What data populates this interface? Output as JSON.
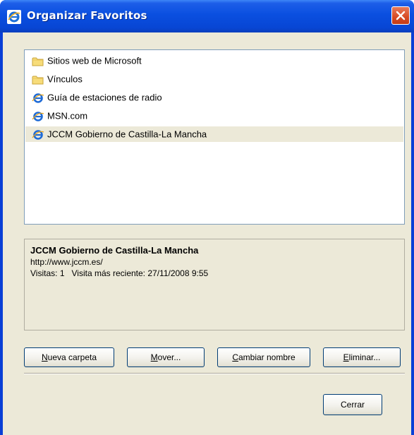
{
  "window": {
    "title": "Organizar Favoritos",
    "accent": "#0a4fe0"
  },
  "favorites": [
    {
      "label": "Sitios web de Microsoft",
      "icon": "folder-icon",
      "selected": false
    },
    {
      "label": "Vínculos",
      "icon": "folder-icon",
      "selected": false
    },
    {
      "label": "Guía de estaciones de radio",
      "icon": "ie-page-icon",
      "selected": false
    },
    {
      "label": "MSN.com",
      "icon": "ie-page-icon",
      "selected": false
    },
    {
      "label": "JCCM Gobierno de Castilla-La Mancha",
      "icon": "ie-page-icon",
      "selected": true
    }
  ],
  "details": {
    "title": "JCCM Gobierno de Castilla-La Mancha",
    "url": "http://www.jccm.es/",
    "visits_label": "Visitas:",
    "visits_value": "1",
    "recent_label": "Visita más reciente:",
    "recent_value": "27/11/2008 9:55"
  },
  "buttons": {
    "new_folder": {
      "accel": "N",
      "rest": "ueva carpeta"
    },
    "move": {
      "accel": "M",
      "rest": "over..."
    },
    "rename": {
      "accel": "C",
      "rest": "ambiar nombre"
    },
    "delete": {
      "accel": "E",
      "rest": "liminar..."
    },
    "close": "Cerrar"
  }
}
